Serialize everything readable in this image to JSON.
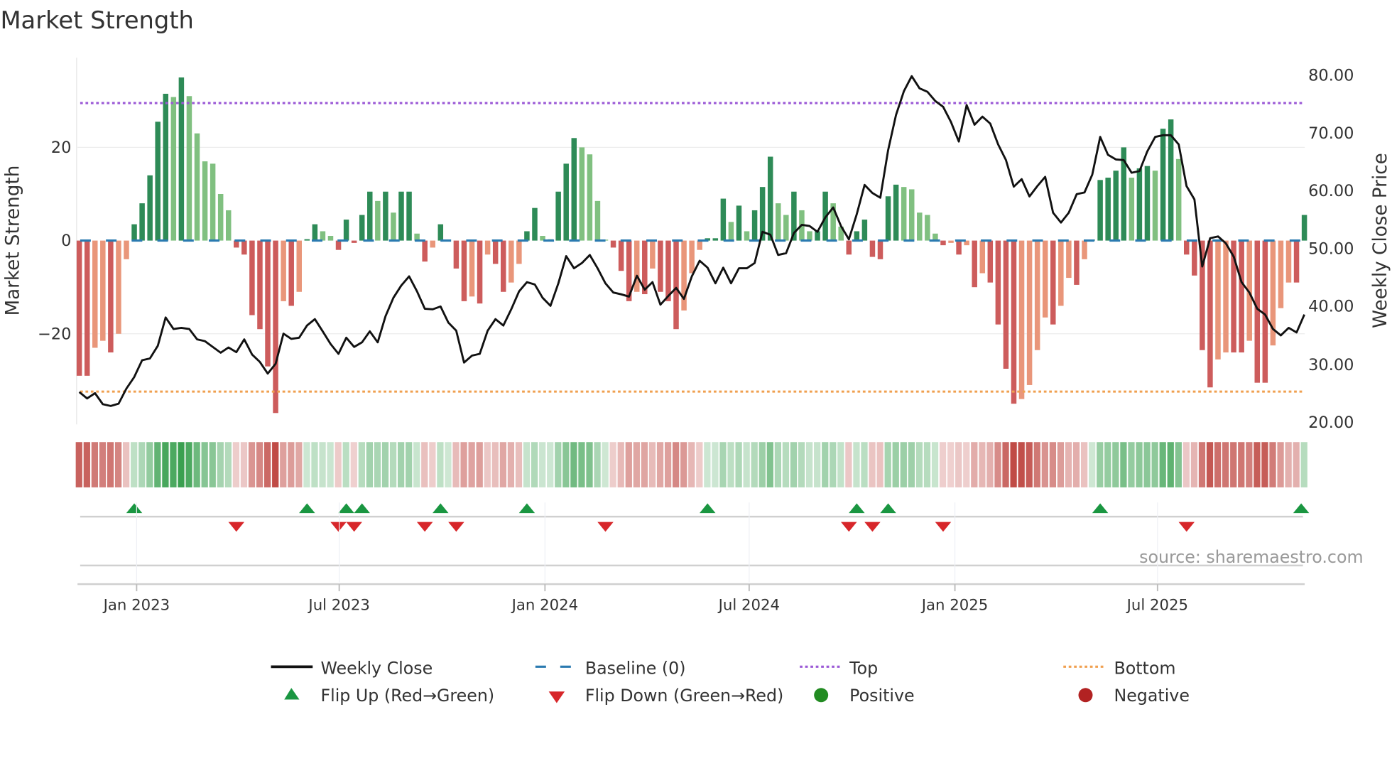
{
  "chart_data": {
    "type": "bar+line",
    "title": "Market Strength",
    "ylabel_left": "Market Strength",
    "ylabel_right": "Weekly Close Price",
    "frequency": "weekly",
    "start_date": "2022-11-11",
    "left_ylim": [
      -39,
      39
    ],
    "right_ylim": [
      18,
      82
    ],
    "left_ticks": [
      "20",
      "0",
      "−20"
    ],
    "left_tick_values": [
      20,
      0,
      -20
    ],
    "right_ticks": [
      "80.00",
      "70.00",
      "60.00",
      "50.00",
      "40.00",
      "30.00",
      "20.00"
    ],
    "right_tick_values": [
      80,
      70,
      60,
      50,
      40,
      30,
      20
    ],
    "x_ticks": [
      "Jan 2023",
      "Jul 2023",
      "Jan 2024",
      "Jul 2024",
      "Jan 2025",
      "Jul 2025"
    ],
    "x_tick_week_index": [
      7.3,
      33.1,
      59.3,
      85.3,
      111.5,
      137.3
    ],
    "top_level": 29.5,
    "bottom_level": -32.4,
    "baseline": 0,
    "market_strength": [
      -29,
      -29,
      -23,
      -21.5,
      -24,
      -20,
      -4,
      3.5,
      8,
      14,
      25.5,
      31.5,
      30.8,
      35,
      31,
      23,
      17,
      16.5,
      10,
      6.5,
      -1.5,
      -3,
      -16,
      -19,
      -27,
      -37,
      -13,
      -14,
      -11,
      0.3,
      3.5,
      2,
      1,
      -2,
      4.5,
      -0.5,
      5.5,
      10.5,
      8.5,
      10.5,
      6,
      10.5,
      10.5,
      1.5,
      -4.5,
      -1.5,
      3.5,
      0.2,
      -6,
      -13,
      -12,
      -13.5,
      -3,
      -5,
      -11,
      -9,
      -5,
      2,
      7,
      1,
      0.3,
      10.5,
      16.5,
      22,
      20,
      18.5,
      8.5,
      0.2,
      -1.5,
      -6.5,
      -13,
      -11,
      -11.5,
      -6,
      -11,
      -13,
      -19,
      -15,
      -7,
      -2,
      0.5,
      0.5,
      9,
      4,
      7.5,
      2,
      6.5,
      11.5,
      18,
      8,
      5.5,
      10.5,
      6.5,
      2,
      2,
      10.5,
      8,
      3,
      -3,
      2,
      4.5,
      -3.5,
      -4,
      9.5,
      12,
      11.5,
      11,
      6,
      5.5,
      1.5,
      -1,
      -0.5,
      -3,
      -1,
      -10,
      -7,
      -9,
      -18,
      -27.5,
      -35,
      -34,
      -31,
      -23.5,
      -16.5,
      -18,
      -14,
      -8,
      -9.5,
      -4,
      0.2,
      13,
      13.5,
      15,
      20,
      13.5,
      15.5,
      16,
      15,
      24,
      26,
      17.5,
      -3,
      -7.5,
      -23.5,
      -31.5,
      -25.5,
      -24,
      -24,
      -24,
      -21.5,
      -30.5,
      -30.5,
      -22.5,
      -14.5,
      -9,
      -9,
      5.5
    ],
    "weekly_close": [
      25.2,
      24.1,
      25.0,
      23.1,
      22.8,
      23.2,
      25.8,
      27.8,
      30.7,
      31.0,
      33.2,
      38.1,
      36.1,
      36.3,
      36.1,
      34.3,
      34.0,
      33.0,
      32.0,
      32.9,
      32.1,
      34.3,
      31.7,
      30.4,
      28.4,
      30.1,
      35.3,
      34.4,
      34.6,
      36.7,
      37.8,
      35.7,
      33.5,
      31.8,
      34.6,
      33.0,
      33.8,
      35.7,
      33.8,
      38.3,
      41.5,
      43.6,
      45.2,
      42.6,
      39.6,
      39.5,
      40.0,
      37.2,
      35.8,
      30.3,
      31.5,
      31.8,
      35.8,
      37.8,
      36.7,
      39.5,
      42.6,
      44.2,
      43.8,
      41.5,
      40.1,
      44.0,
      48.7,
      46.6,
      47.5,
      48.9,
      46.6,
      44.0,
      42.4,
      42.1,
      41.7,
      45.3,
      42.9,
      44.2,
      40.3,
      41.8,
      43.2,
      41.3,
      45.2,
      47.9,
      46.7,
      44.0,
      46.7,
      44.0,
      46.6,
      46.6,
      47.5,
      52.9,
      52.4,
      48.9,
      49.2,
      52.7,
      54.1,
      53.9,
      52.9,
      55.4,
      57.1,
      53.9,
      51.6,
      55.9,
      61.0,
      59.6,
      58.8,
      67.0,
      73.1,
      77.2,
      79.8,
      77.7,
      77.1,
      75.5,
      74.5,
      71.9,
      68.5,
      74.8,
      71.4,
      72.8,
      71.6,
      68.0,
      65.3,
      60.7,
      62.0,
      59.0,
      60.8,
      62.4,
      56.2,
      54.5,
      56.2,
      59.4,
      59.7,
      62.8,
      69.3,
      66.2,
      65.4,
      65.3,
      63.1,
      63.4,
      66.8,
      69.3,
      69.6,
      69.6,
      68.0,
      60.8,
      58.5,
      46.9,
      51.8,
      52.1,
      50.9,
      48.6,
      44.2,
      42.4,
      39.6,
      38.6,
      36.1,
      35.0,
      36.3,
      35.5,
      38.6
    ],
    "flip_up_index": [
      7,
      29,
      34,
      36,
      46,
      57,
      80,
      99,
      103,
      130,
      156
    ],
    "flip_down_index": [
      20,
      33,
      35,
      44,
      48,
      67,
      98,
      101,
      110,
      141
    ],
    "legend": {
      "weekly_close": "Weekly Close",
      "baseline": "Baseline (0)",
      "top": "Top",
      "bottom": "Bottom",
      "flip_up": "Flip Up (Red→Green)",
      "flip_down": "Flip Down (Green→Red)",
      "positive": "Positive",
      "negative": "Negative"
    },
    "legend_placement": "bottom-center",
    "colors": {
      "pos_rising": "#2e8b57",
      "pos_falling": "#80c080",
      "neg_falling": "#cd5c5c",
      "neg_rising": "#e9967a",
      "line": "#111111",
      "baseline": "#2a7ab0",
      "top": "#9b59d6",
      "bottom": "#f0a050",
      "flip_up": "#1a9641",
      "flip_down": "#d7262a",
      "positive": "#228b22",
      "negative": "#b22222"
    }
  },
  "source": "source: sharemaestro.com"
}
